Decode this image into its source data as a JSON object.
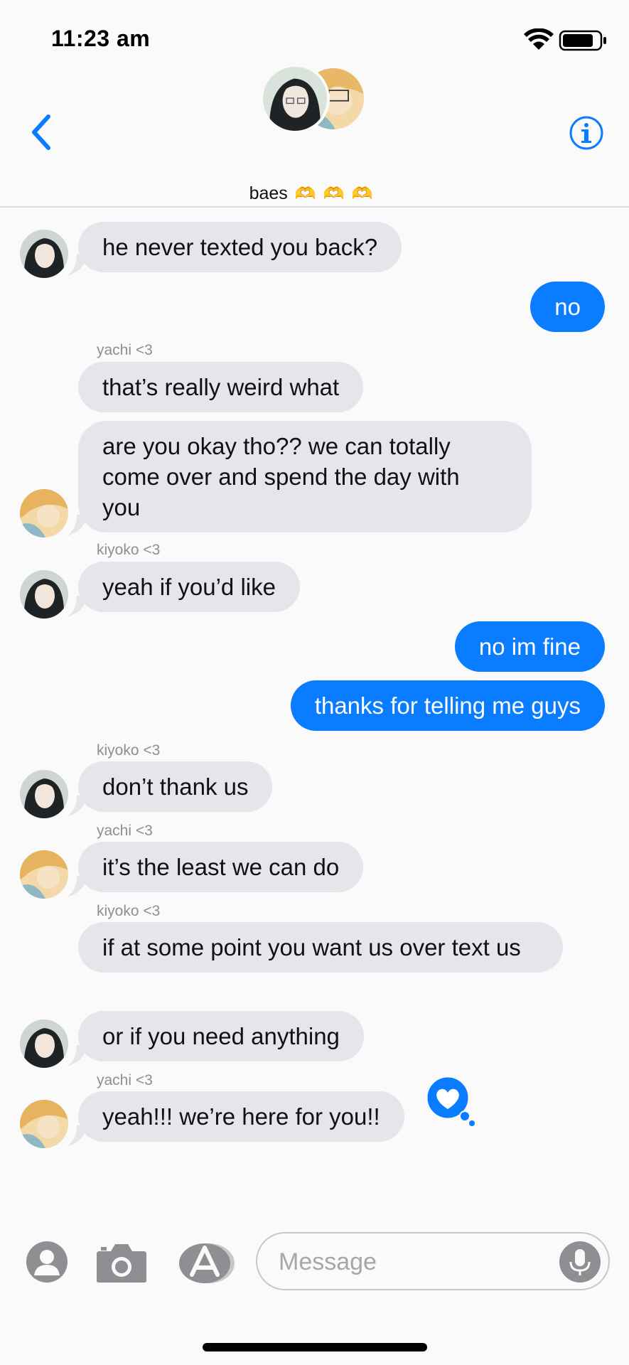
{
  "status_bar": {
    "time": "11:23 am"
  },
  "conversation": {
    "title": "baes",
    "title_emoji": "🫶🫶🫶"
  },
  "messages": [
    {
      "from": "kiyoko",
      "text": "he never texted you back?"
    },
    {
      "from": "me",
      "text": "no"
    },
    {
      "sender_label": "yachi <3",
      "from": "yachi",
      "text": "that’s really weird what"
    },
    {
      "from": "yachi",
      "text": "are you okay tho?? we can totally come over and spend the day with you"
    },
    {
      "sender_label": "kiyoko <3",
      "from": "kiyoko",
      "text": "yeah if you’d like"
    },
    {
      "from": "me",
      "text": "no im fine"
    },
    {
      "from": "me",
      "text": "thanks for telling me guys"
    },
    {
      "sender_label": "kiyoko <3",
      "from": "kiyoko",
      "text": "don’t thank us"
    },
    {
      "sender_label": "yachi <3",
      "from": "yachi",
      "text": "it’s the least we can do"
    },
    {
      "sender_label": "kiyoko <3",
      "from": "kiyoko",
      "text": "if at some point you want us over text us"
    },
    {
      "from": "kiyoko",
      "text": "or if you need anything"
    },
    {
      "sender_label": "yachi <3",
      "from": "yachi",
      "text": "yeah!!! we’re here for you!!",
      "tapback": "heart"
    }
  ],
  "input_bar": {
    "placeholder": "Message"
  },
  "colors": {
    "accent": "#0a7cff",
    "incoming_bubble": "#e6e5eb"
  },
  "icons": [
    "back-chevron",
    "info",
    "contact",
    "camera",
    "app-store",
    "microphone",
    "heart-tapback",
    "wifi",
    "battery"
  ]
}
